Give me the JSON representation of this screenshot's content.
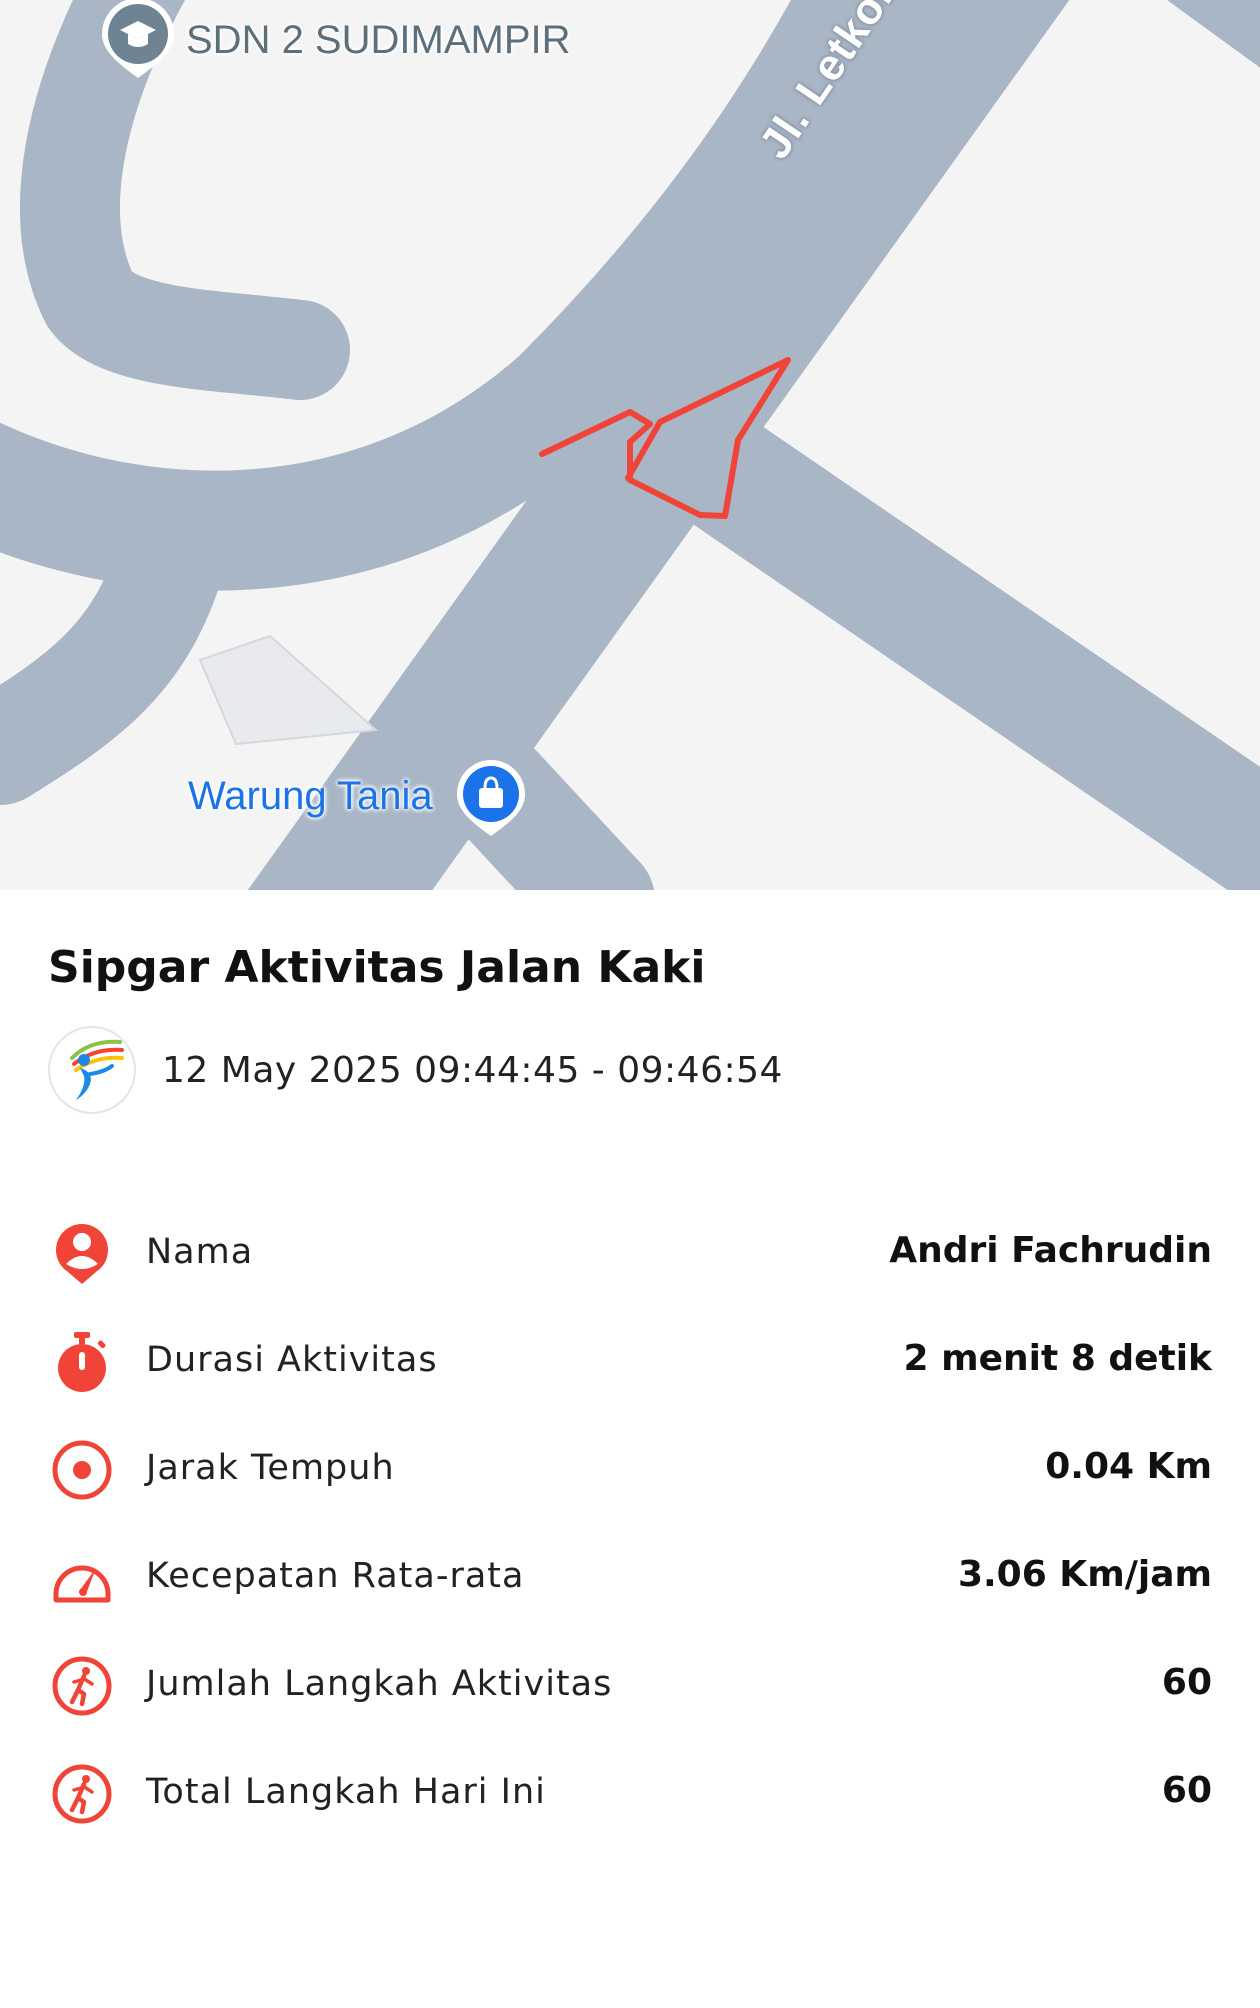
{
  "map": {
    "poi_school": "SDN 2 SUDIMAMPIR",
    "poi_shop": "Warung Tania",
    "street": "Jl. Letkol G.A. M",
    "route_color": "#f04438",
    "road_color": "#a9b6c6"
  },
  "activity": {
    "title": "Sipgar Aktivitas Jalan Kaki",
    "timestamp": "12 May 2025 09:44:45 - 09:46:54"
  },
  "stats": [
    {
      "icon": "person-pin-icon",
      "label": "Nama",
      "value": "Andri Fachrudin"
    },
    {
      "icon": "stopwatch-icon",
      "label": "Durasi Aktivitas",
      "value": "2 menit 8 detik"
    },
    {
      "icon": "target-icon",
      "label": "Jarak Tempuh",
      "value": "0.04 Km"
    },
    {
      "icon": "speedometer-icon",
      "label": "Kecepatan Rata-rata",
      "value": "3.06 Km/jam"
    },
    {
      "icon": "walking-person-icon",
      "label": "Jumlah Langkah Aktivitas",
      "value": "60"
    },
    {
      "icon": "walking-person-icon",
      "label": "Total Langkah Hari Ini",
      "value": "60"
    }
  ],
  "colors": {
    "accent": "#f04438"
  }
}
